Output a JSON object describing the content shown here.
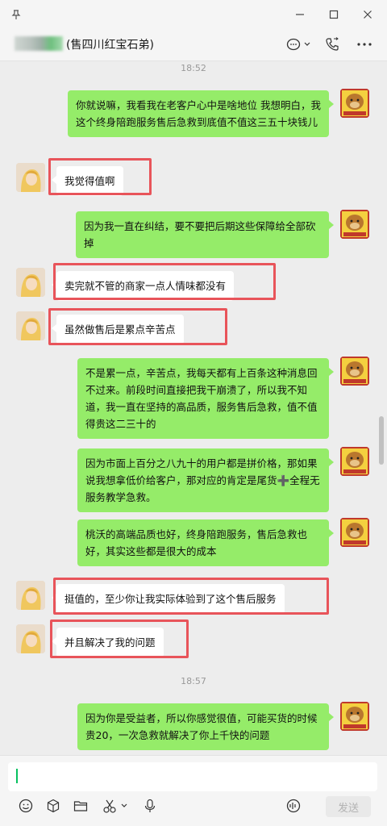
{
  "window": {
    "pin_icon": "pin-icon",
    "minimize_icon": "minimize-icon",
    "maximize_icon": "maximize-icon",
    "close_icon": "close-icon"
  },
  "header": {
    "title": "(售四川红宝石弟)",
    "chat_icon": "chat-bubble-icon",
    "call_icon": "phone-icon",
    "more_icon": "more-icon"
  },
  "messages": {
    "time_1": "18:52",
    "time_2": "18:57",
    "m1": "你就说嘛，我看我在老客户心中是啥地位  我想明白，我这个终身陪跑服务售后急救到底值不值这三五十块钱儿",
    "m2": "我觉得值啊",
    "m3": "因为我一直在纠结，要不要把后期这些保障给全部砍掉",
    "m4": "卖完就不管的商家一点人情味都没有",
    "m5": "虽然做售后是累点辛苦点",
    "m6": "不是累一点，辛苦点，我每天都有上百条这种消息回不过来。前段时间直接把我干崩溃了，所以我不知道，我一直在坚持的高品质，服务售后急救，值不值得贵这二三十的",
    "m7": "因为市面上百分之八九十的用户都是拼价格，那如果说我想拿低价给客户，那对应的肯定是尾货➕全程无服务教学急救。",
    "m8": "桃沃的高端品质也好，终身陪跑服务，售后急救也好，其实这些都是很大的成本",
    "m9": "挺值的，至少你让我实际体验到了这个售后服务",
    "m10": "并且解决了我的问题",
    "m11": "因为你是受益者，所以你感觉很值，可能买货的时候贵20，一次急救就解决了你上千快的问题"
  },
  "composer": {
    "send_label": "发送",
    "input_value": ""
  },
  "colors": {
    "sent_bubble": "#95ec69",
    "received_bubble": "#ffffff",
    "highlight": "#e8545a",
    "background": "#ededed"
  }
}
